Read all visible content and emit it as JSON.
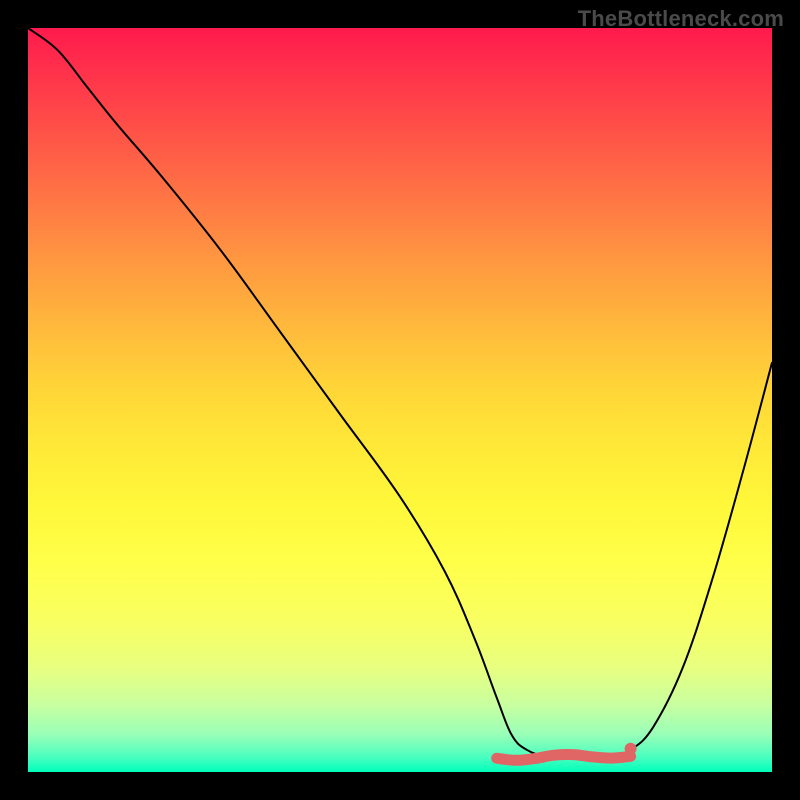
{
  "watermark": "TheBottleneck.com",
  "colors": {
    "curve": "#000000",
    "marker": "#e06666",
    "background": "#000000"
  },
  "chart_data": {
    "type": "line",
    "title": "",
    "xlabel": "",
    "ylabel": "",
    "xlim": [
      0,
      100
    ],
    "ylim": [
      0,
      100
    ],
    "grid": false,
    "legend": false,
    "description": "Bottleneck-style curve: high on the left, descends steeply to a flat minimum region, then rises again toward the right.",
    "series": [
      {
        "name": "curve",
        "x": [
          0,
          4,
          8,
          12,
          18,
          26,
          34,
          42,
          50,
          56,
          60,
          63,
          65,
          67,
          70,
          74,
          78,
          81,
          84,
          88,
          92,
          96,
          100
        ],
        "y": [
          100,
          97,
          92,
          87,
          80,
          70,
          59,
          48,
          37,
          27,
          18,
          10,
          5,
          3,
          2,
          2,
          2,
          3,
          6,
          14,
          26,
          40,
          55
        ]
      }
    ],
    "minimum_band": {
      "x_start": 63,
      "x_end": 81,
      "y": 2
    },
    "minimum_dot": {
      "x": 81,
      "y": 3
    }
  }
}
